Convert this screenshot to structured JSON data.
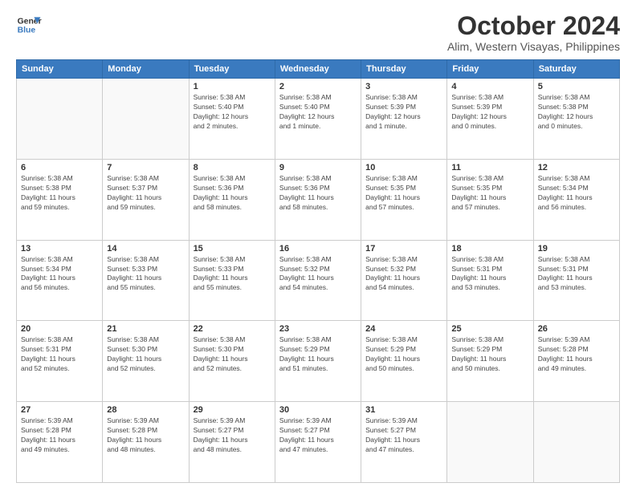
{
  "header": {
    "logo_line1": "General",
    "logo_line2": "Blue",
    "month": "October 2024",
    "location": "Alim, Western Visayas, Philippines"
  },
  "days_of_week": [
    "Sunday",
    "Monday",
    "Tuesday",
    "Wednesday",
    "Thursday",
    "Friday",
    "Saturday"
  ],
  "weeks": [
    [
      {
        "day": "",
        "detail": ""
      },
      {
        "day": "",
        "detail": ""
      },
      {
        "day": "1",
        "detail": "Sunrise: 5:38 AM\nSunset: 5:40 PM\nDaylight: 12 hours\nand 2 minutes."
      },
      {
        "day": "2",
        "detail": "Sunrise: 5:38 AM\nSunset: 5:40 PM\nDaylight: 12 hours\nand 1 minute."
      },
      {
        "day": "3",
        "detail": "Sunrise: 5:38 AM\nSunset: 5:39 PM\nDaylight: 12 hours\nand 1 minute."
      },
      {
        "day": "4",
        "detail": "Sunrise: 5:38 AM\nSunset: 5:39 PM\nDaylight: 12 hours\nand 0 minutes."
      },
      {
        "day": "5",
        "detail": "Sunrise: 5:38 AM\nSunset: 5:38 PM\nDaylight: 12 hours\nand 0 minutes."
      }
    ],
    [
      {
        "day": "6",
        "detail": "Sunrise: 5:38 AM\nSunset: 5:38 PM\nDaylight: 11 hours\nand 59 minutes."
      },
      {
        "day": "7",
        "detail": "Sunrise: 5:38 AM\nSunset: 5:37 PM\nDaylight: 11 hours\nand 59 minutes."
      },
      {
        "day": "8",
        "detail": "Sunrise: 5:38 AM\nSunset: 5:36 PM\nDaylight: 11 hours\nand 58 minutes."
      },
      {
        "day": "9",
        "detail": "Sunrise: 5:38 AM\nSunset: 5:36 PM\nDaylight: 11 hours\nand 58 minutes."
      },
      {
        "day": "10",
        "detail": "Sunrise: 5:38 AM\nSunset: 5:35 PM\nDaylight: 11 hours\nand 57 minutes."
      },
      {
        "day": "11",
        "detail": "Sunrise: 5:38 AM\nSunset: 5:35 PM\nDaylight: 11 hours\nand 57 minutes."
      },
      {
        "day": "12",
        "detail": "Sunrise: 5:38 AM\nSunset: 5:34 PM\nDaylight: 11 hours\nand 56 minutes."
      }
    ],
    [
      {
        "day": "13",
        "detail": "Sunrise: 5:38 AM\nSunset: 5:34 PM\nDaylight: 11 hours\nand 56 minutes."
      },
      {
        "day": "14",
        "detail": "Sunrise: 5:38 AM\nSunset: 5:33 PM\nDaylight: 11 hours\nand 55 minutes."
      },
      {
        "day": "15",
        "detail": "Sunrise: 5:38 AM\nSunset: 5:33 PM\nDaylight: 11 hours\nand 55 minutes."
      },
      {
        "day": "16",
        "detail": "Sunrise: 5:38 AM\nSunset: 5:32 PM\nDaylight: 11 hours\nand 54 minutes."
      },
      {
        "day": "17",
        "detail": "Sunrise: 5:38 AM\nSunset: 5:32 PM\nDaylight: 11 hours\nand 54 minutes."
      },
      {
        "day": "18",
        "detail": "Sunrise: 5:38 AM\nSunset: 5:31 PM\nDaylight: 11 hours\nand 53 minutes."
      },
      {
        "day": "19",
        "detail": "Sunrise: 5:38 AM\nSunset: 5:31 PM\nDaylight: 11 hours\nand 53 minutes."
      }
    ],
    [
      {
        "day": "20",
        "detail": "Sunrise: 5:38 AM\nSunset: 5:31 PM\nDaylight: 11 hours\nand 52 minutes."
      },
      {
        "day": "21",
        "detail": "Sunrise: 5:38 AM\nSunset: 5:30 PM\nDaylight: 11 hours\nand 52 minutes."
      },
      {
        "day": "22",
        "detail": "Sunrise: 5:38 AM\nSunset: 5:30 PM\nDaylight: 11 hours\nand 52 minutes."
      },
      {
        "day": "23",
        "detail": "Sunrise: 5:38 AM\nSunset: 5:29 PM\nDaylight: 11 hours\nand 51 minutes."
      },
      {
        "day": "24",
        "detail": "Sunrise: 5:38 AM\nSunset: 5:29 PM\nDaylight: 11 hours\nand 50 minutes."
      },
      {
        "day": "25",
        "detail": "Sunrise: 5:38 AM\nSunset: 5:29 PM\nDaylight: 11 hours\nand 50 minutes."
      },
      {
        "day": "26",
        "detail": "Sunrise: 5:39 AM\nSunset: 5:28 PM\nDaylight: 11 hours\nand 49 minutes."
      }
    ],
    [
      {
        "day": "27",
        "detail": "Sunrise: 5:39 AM\nSunset: 5:28 PM\nDaylight: 11 hours\nand 49 minutes."
      },
      {
        "day": "28",
        "detail": "Sunrise: 5:39 AM\nSunset: 5:28 PM\nDaylight: 11 hours\nand 48 minutes."
      },
      {
        "day": "29",
        "detail": "Sunrise: 5:39 AM\nSunset: 5:27 PM\nDaylight: 11 hours\nand 48 minutes."
      },
      {
        "day": "30",
        "detail": "Sunrise: 5:39 AM\nSunset: 5:27 PM\nDaylight: 11 hours\nand 47 minutes."
      },
      {
        "day": "31",
        "detail": "Sunrise: 5:39 AM\nSunset: 5:27 PM\nDaylight: 11 hours\nand 47 minutes."
      },
      {
        "day": "",
        "detail": ""
      },
      {
        "day": "",
        "detail": ""
      }
    ]
  ]
}
